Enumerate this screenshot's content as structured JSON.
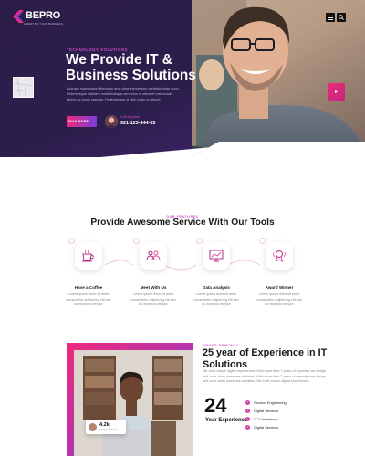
{
  "header": {
    "logo_text": "BEPRO",
    "logo_tagline": "ASSIST TO YOUR BUSINESS"
  },
  "hero": {
    "eyebrow": "TECHNOLOGY SOLUTIONS",
    "title": "We Provide  IT  & Business Solutions",
    "description": "Aliquam malesuada bibendum arcu vitae elementum curabitur vitae nunc. Pellentesque habitant morbi tristique senectus et netus et malesuada fames ac turpis egestas. Pellentesque id nibh tortor id aliquet.",
    "read_more_label": "READ MORE",
    "contact_label": "Call Anytime",
    "contact_number": "921-123-444-55",
    "next_icon": "chevron-right-icon"
  },
  "services": {
    "eyebrow": "OUR FEATURES",
    "title": "Provide Awesome Service With Our Tools",
    "items": [
      {
        "name": "Have a Coffee",
        "icon": "coffee-icon",
        "desc": "Lorem ipsum dolor sit amet consectetur adipiscing elit sed do eiusmod tempor"
      },
      {
        "name": "Meet With Us",
        "icon": "meeting-icon",
        "desc": "Lorem ipsum dolor sit amet consectetur adipiscing elit sed do eiusmod tempor"
      },
      {
        "name": "Data Analysis",
        "icon": "analytics-icon",
        "desc": "Lorem ipsum dolor sit amet consectetur adipiscing elit sed do eiusmod tempor"
      },
      {
        "name": "Award Winner",
        "icon": "award-icon",
        "desc": "Lorem ipsum dolor sit amet consectetur adipiscing elit sed do eiusmod tempor"
      }
    ]
  },
  "experience": {
    "eyebrow": "ABOUT COMPANY",
    "title": "25 year of Experience in IT Solutions",
    "description": "We craft unique digital experiences. With more than 7 years of expertise we design and code clean awesome websites. With more than 7 years of expertise we design and code clean awesome websites. We craft unique digital experiences.",
    "years_number": "24",
    "years_label": "Year Experience",
    "list": [
      "Product Engineering",
      "Digital Services",
      "IT Consultancy",
      "Digital Services"
    ],
    "badge_number": "4.2k",
    "badge_label": "Satisfied Clients"
  },
  "colors": {
    "accent_pink": "#ee2a7b",
    "accent_purple": "#7d3ddb",
    "hero_dark": "#2b1d47"
  }
}
